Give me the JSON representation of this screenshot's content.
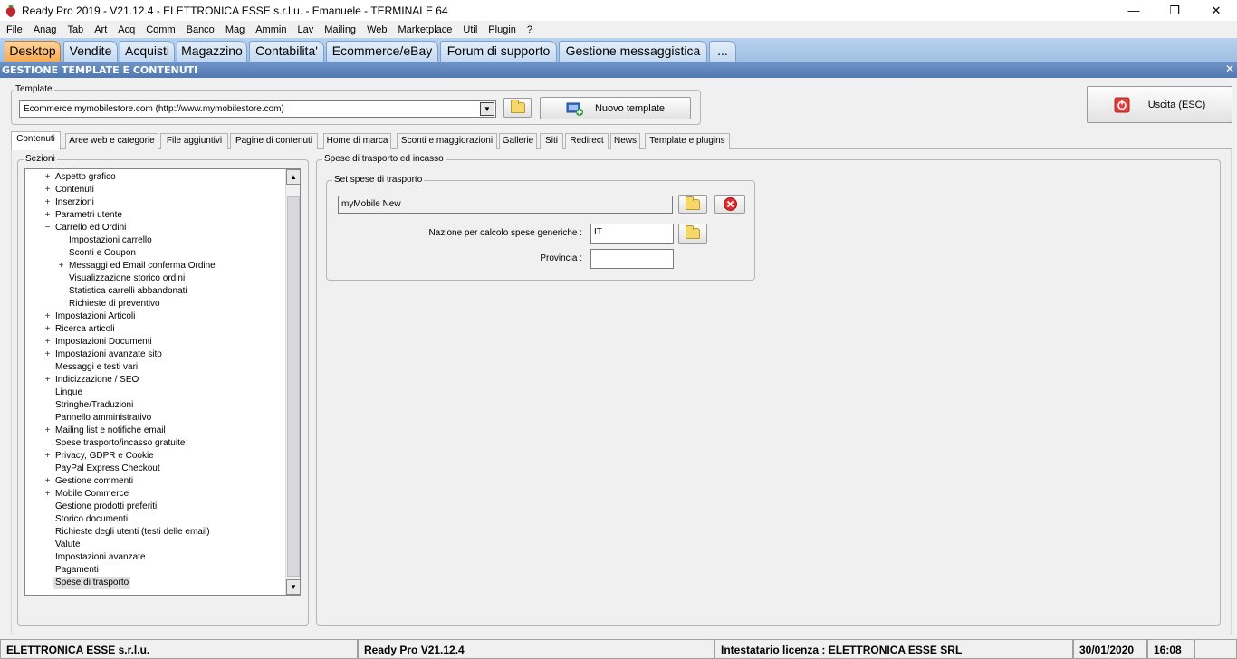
{
  "window": {
    "title": "Ready Pro 2019 - V21.12.4 - ELETTRONICA ESSE s.r.l.u. - Emanuele - TERMINALE 64",
    "minimize": "—",
    "maximize": "❐",
    "close": "✕"
  },
  "menu": [
    "File",
    "Anag",
    "Tab",
    "Art",
    "Acq",
    "Comm",
    "Banco",
    "Mag",
    "Ammin",
    "Lav",
    "Mailing",
    "Web",
    "Marketplace",
    "Util",
    "Plugin",
    "?"
  ],
  "main_tabs": [
    "Desktop",
    "Vendite",
    "Acquisti",
    "Magazzino",
    "Contabilita'",
    "Ecommerce/eBay",
    "Forum di supporto",
    "Gestione messaggistica",
    "..."
  ],
  "section_title": "GESTIONE TEMPLATE E CONTENUTI",
  "section_close": "✕",
  "template": {
    "label": "Template",
    "selected": "Ecommerce mymobilestore.com (http://www.mymobilestore.com)",
    "new_button": "Nuovo template"
  },
  "exit_button": "Uscita (ESC)",
  "sub_tabs": [
    "Contenuti",
    "Aree web e categorie",
    "File aggiuntivi",
    "Pagine di contenuti",
    "Home di marca",
    "Sconti e maggiorazioni",
    "Gallerie",
    "Siti",
    "Redirect",
    "News",
    "Template e plugins"
  ],
  "sections": {
    "label": "Sezioni",
    "items": [
      {
        "label": "Aspetto grafico",
        "level": 0,
        "expander": "+"
      },
      {
        "label": "Contenuti",
        "level": 0,
        "expander": "+"
      },
      {
        "label": "Inserzioni",
        "level": 0,
        "expander": "+"
      },
      {
        "label": "Parametri utente",
        "level": 0,
        "expander": "+"
      },
      {
        "label": "Carrello ed Ordini",
        "level": 0,
        "expander": "−"
      },
      {
        "label": "Impostazioni carrello",
        "level": 1,
        "expander": ""
      },
      {
        "label": "Sconti e Coupon",
        "level": 1,
        "expander": ""
      },
      {
        "label": "Messaggi ed Email conferma Ordine",
        "level": 1,
        "expander": "+"
      },
      {
        "label": "Visualizzazione storico ordini",
        "level": 1,
        "expander": ""
      },
      {
        "label": "Statistica carrelli abbandonati",
        "level": 1,
        "expander": ""
      },
      {
        "label": "Richieste di preventivo",
        "level": 1,
        "expander": ""
      },
      {
        "label": "Impostazioni Articoli",
        "level": 0,
        "expander": "+"
      },
      {
        "label": "Ricerca articoli",
        "level": 0,
        "expander": "+"
      },
      {
        "label": "Impostazioni Documenti",
        "level": 0,
        "expander": "+"
      },
      {
        "label": "Impostazioni avanzate sito",
        "level": 0,
        "expander": "+"
      },
      {
        "label": "Messaggi e testi vari",
        "level": 0,
        "expander": ""
      },
      {
        "label": "Indicizzazione / SEO",
        "level": 0,
        "expander": "+"
      },
      {
        "label": "Lingue",
        "level": 0,
        "expander": ""
      },
      {
        "label": "Stringhe/Traduzioni",
        "level": 0,
        "expander": ""
      },
      {
        "label": "Pannello amministrativo",
        "level": 0,
        "expander": ""
      },
      {
        "label": "Mailing list e notifiche email",
        "level": 0,
        "expander": "+"
      },
      {
        "label": "Spese trasporto/incasso gratuite",
        "level": 0,
        "expander": ""
      },
      {
        "label": "Privacy, GDPR e Cookie",
        "level": 0,
        "expander": "+"
      },
      {
        "label": "PayPal Express Checkout",
        "level": 0,
        "expander": ""
      },
      {
        "label": "Gestione commenti",
        "level": 0,
        "expander": "+"
      },
      {
        "label": "Mobile Commerce",
        "level": 0,
        "expander": "+"
      },
      {
        "label": "Gestione prodotti preferiti",
        "level": 0,
        "expander": ""
      },
      {
        "label": "Storico documenti",
        "level": 0,
        "expander": ""
      },
      {
        "label": "Richieste degli utenti (testi delle email)",
        "level": 0,
        "expander": ""
      },
      {
        "label": "Valute",
        "level": 0,
        "expander": ""
      },
      {
        "label": "Impostazioni avanzate",
        "level": 0,
        "expander": ""
      },
      {
        "label": "Pagamenti",
        "level": 0,
        "expander": ""
      },
      {
        "label": "Spese di trasporto",
        "level": 0,
        "expander": "",
        "selected": true
      }
    ]
  },
  "shipping": {
    "group_label": "Spese di trasporto ed incasso",
    "set_label": "Set spese di trasporto",
    "set_value": "myMobile New",
    "nation_label": "Nazione per calcolo spese generiche :",
    "nation_value": "IT",
    "province_label": "Provincia :",
    "province_value": ""
  },
  "status_bar": {
    "company": "ELETTRONICA ESSE s.r.l.u.",
    "version": "Ready Pro V21.12.4",
    "license": "Intestatario licenza : ELETTRONICA ESSE SRL",
    "date": "30/01/2020",
    "time": "16:08"
  }
}
